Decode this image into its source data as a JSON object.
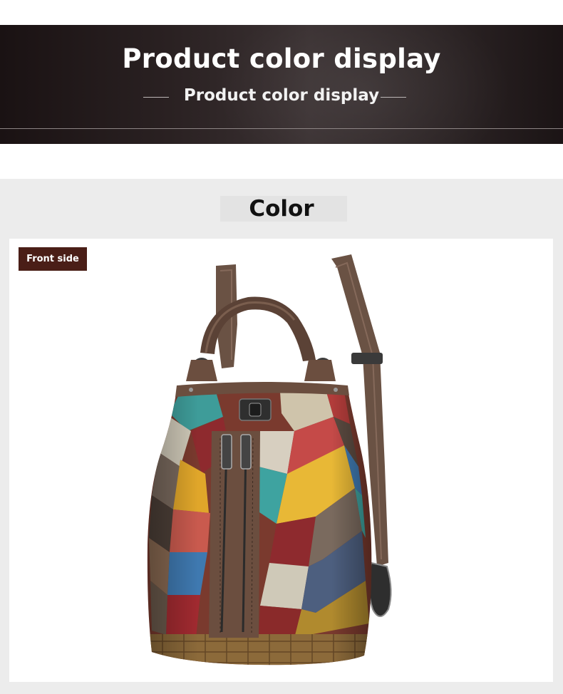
{
  "banner": {
    "title": "Product color display",
    "subtitle": "Product color display"
  },
  "section": {
    "title": "Color",
    "badge": "Front side"
  },
  "colors": {
    "banner_bg": "#2a2122",
    "section_bg": "#ececec",
    "badge_bg": "#4a1e17",
    "strap": "#6a5244",
    "leather": "#6b4e3f"
  },
  "image": {
    "subject": "patchwork-leather-backpack"
  }
}
